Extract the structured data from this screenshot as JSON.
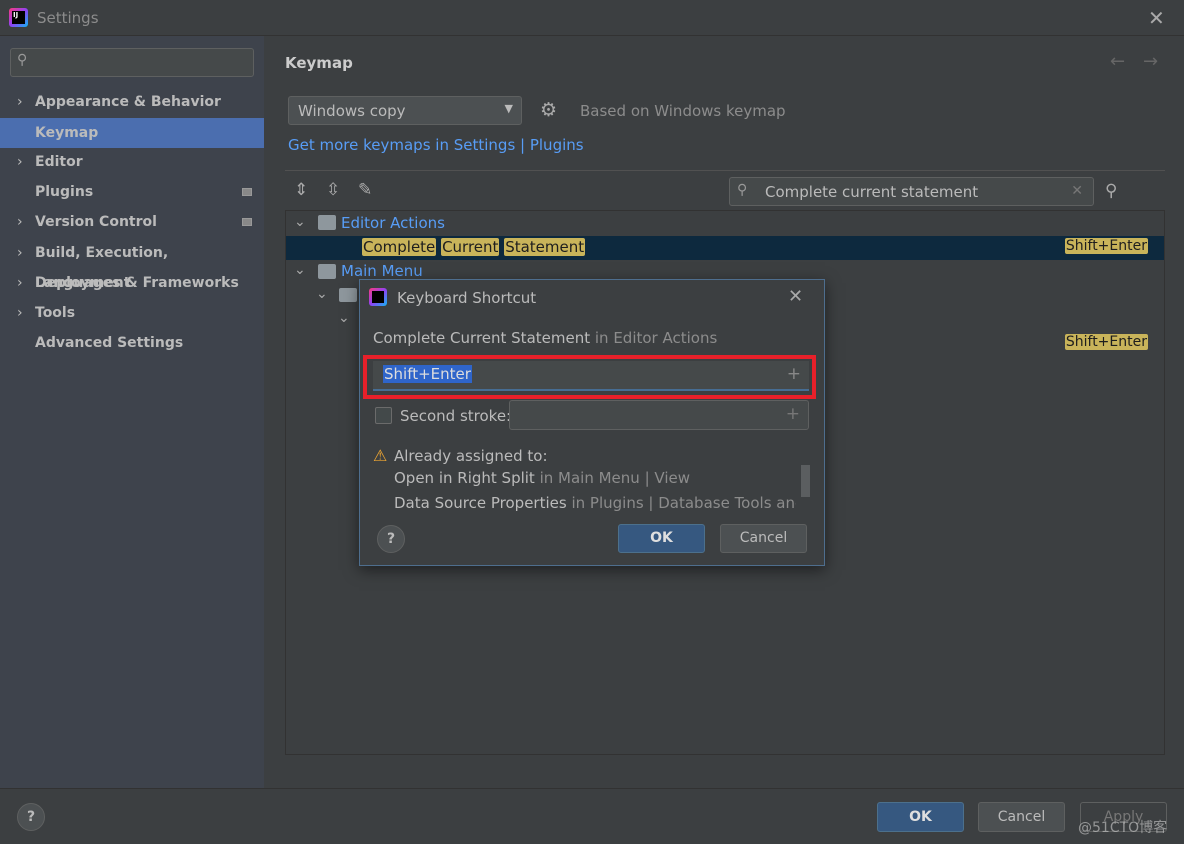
{
  "window": {
    "title": "Settings"
  },
  "sidebar": {
    "search_placeholder": "",
    "items": [
      {
        "label": "Appearance & Behavior",
        "expandable": true
      },
      {
        "label": "Keymap",
        "selected": true
      },
      {
        "label": "Editor",
        "expandable": true
      },
      {
        "label": "Plugins",
        "badge": true
      },
      {
        "label": "Version Control",
        "expandable": true,
        "badge": true
      },
      {
        "label": "Build, Execution, Deployment",
        "expandable": true
      },
      {
        "label": "Languages & Frameworks",
        "expandable": true
      },
      {
        "label": "Tools",
        "expandable": true
      },
      {
        "label": "Advanced Settings"
      }
    ]
  },
  "main": {
    "title": "Keymap",
    "keymap_select": "Windows copy",
    "based_on": "Based on Windows keymap",
    "get_more_link": "Get more keymaps in Settings | Plugins",
    "search_value": "Complete current statement",
    "tree": {
      "group1": "Editor Actions",
      "action_words": [
        "Complete",
        "Current",
        "Statement"
      ],
      "action_shortcut": "Shift+Enter",
      "group2": "Main Menu",
      "nested_shortcut": "Shift+Enter"
    }
  },
  "dialog": {
    "title": "Keyboard Shortcut",
    "action": "Complete Current Statement",
    "action_location": "in Editor Actions",
    "shortcut_value": "Shift+Enter",
    "second_stroke_label": "Second stroke:",
    "second_stroke_checked": false,
    "warning": "Already assigned to:",
    "conflicts": [
      {
        "name": "Open in Right Split",
        "location": "in Main Menu | View"
      },
      {
        "name": "Data Source Properties",
        "location": "in Plugins | Database Tools and SQ"
      }
    ],
    "ok": "OK",
    "cancel": "Cancel",
    "help": "?"
  },
  "footer": {
    "ok": "OK",
    "cancel": "Cancel",
    "apply": "Apply",
    "help": "?"
  },
  "watermark": "@51CTO博客",
  "colors": {
    "accent": "#4b6eaf",
    "highlight_box": "#e8202a",
    "match_highlight": "#c9b45a",
    "link": "#589df6"
  }
}
